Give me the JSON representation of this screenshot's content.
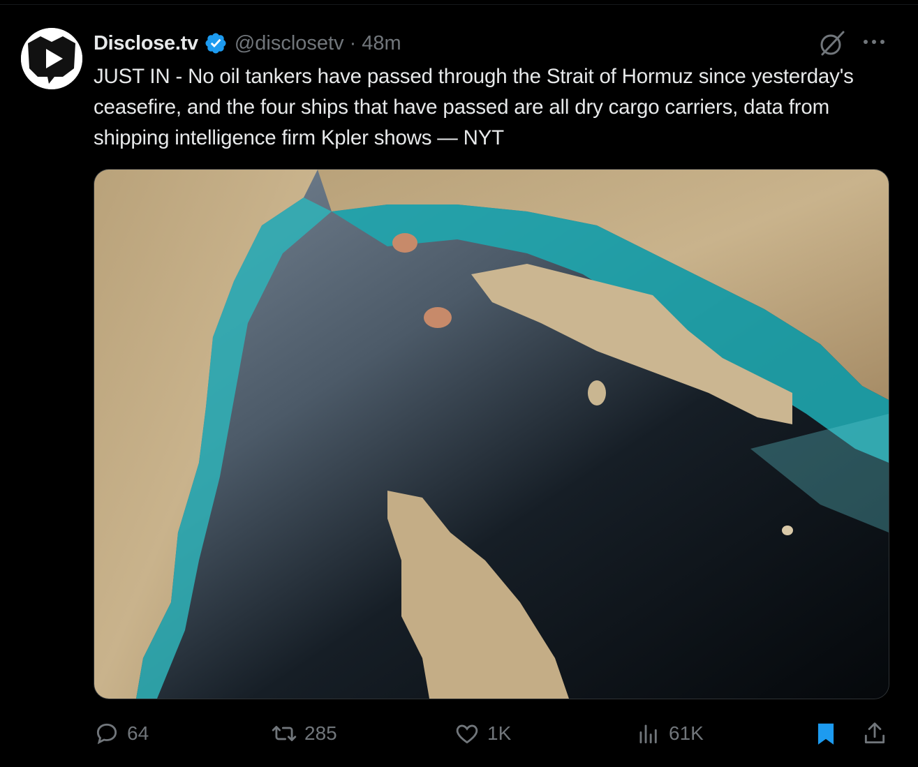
{
  "tweet": {
    "author_name": "Disclose.tv",
    "handle": "@disclosetv",
    "separator": "·",
    "time": "48m",
    "text": "JUST IN - No oil tankers have passed through the Strait of Hormuz since yesterday's ceasefire, and the four ships that have passed are all dry cargo carriers, data from shipping intelligence firm Kpler shows — NYT",
    "media": {
      "description_icon": "satellite-image"
    }
  },
  "icons": {
    "avatar": "disclose-tv-logo",
    "verified": "verified-badge-icon",
    "grok": "grok-icon",
    "more": "more-icon",
    "reply": "reply-icon",
    "retweet": "retweet-icon",
    "like": "heart-icon",
    "views": "views-icon",
    "bookmark": "bookmark-icon",
    "share": "share-icon"
  },
  "actions": {
    "replies": "64",
    "retweets": "285",
    "likes": "1K",
    "views": "61K"
  },
  "colors": {
    "background": "#000000",
    "text": "#e7e9ea",
    "muted": "#71767b",
    "verified": "#1d9bf0",
    "bookmark": "#1d9bf0"
  }
}
